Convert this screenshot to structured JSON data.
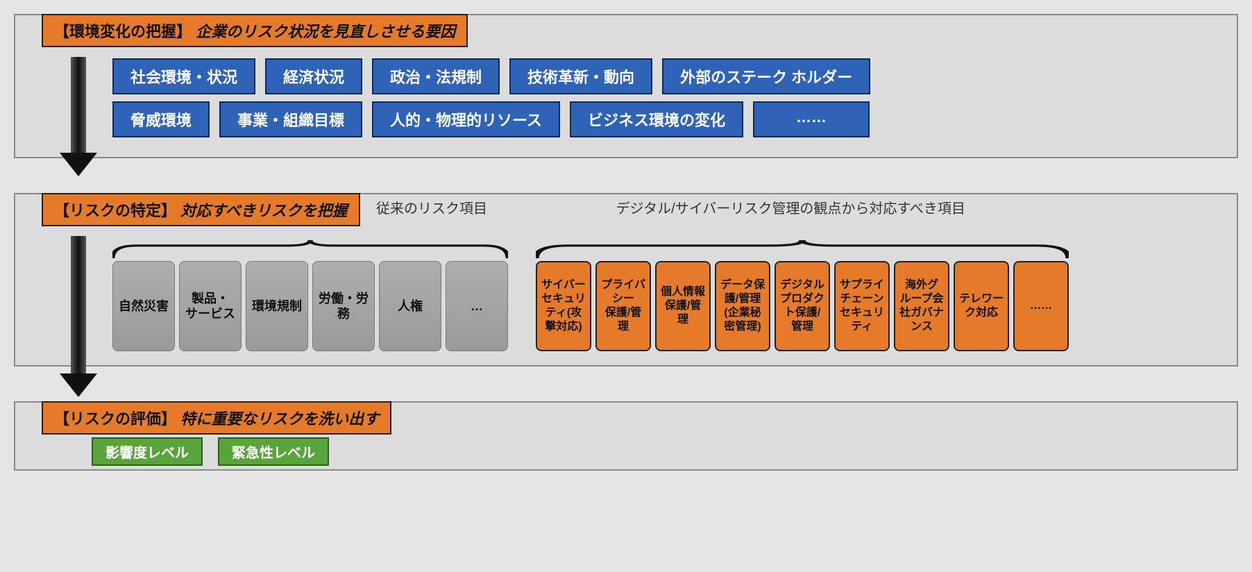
{
  "sections": {
    "env": {
      "title": "【環境変化の把握】",
      "desc": "企業のリスク状況を見直しさせる要因",
      "row1": [
        "社会環境・状況",
        "経済状況",
        "政治・法規制",
        "技術革新・動向",
        "外部のステーク ホルダー"
      ],
      "row2": [
        "脅威環境",
        "事業・組織目標",
        "人的・物理的リソース",
        "ビジネス環境の変化",
        "……"
      ]
    },
    "identify": {
      "title": "【リスクの特定】",
      "desc": "対応すべきリスクを把握",
      "sub1": "従来のリスク項目",
      "sub2": "デジタル/サイバーリスク管理の観点から対応すべき項目",
      "conventional": [
        "自然災害",
        "製品・\nサービス",
        "環境規制",
        "労働・労\n務",
        "人権",
        "…"
      ],
      "digital": [
        "サイバー\nセキュリ\nティ(攻\n撃対応)",
        "プライバ\nシー\n保護/管\n理",
        "個人情報\n保護/管\n理",
        "データ保\n護/管理\n(企業秘\n密管理)",
        "デジタル\nプロダク\nト保護/\n管理",
        "サプライ\nチェーン\nセキュリ\nティ",
        "海外グ\nループ会\n社ガバナ\nンス",
        "テレワー\nク対応",
        "……"
      ]
    },
    "eval": {
      "title": "【リスクの評価】",
      "desc": "特に重要なリスクを洗い出す",
      "tags": [
        "影響度レベル",
        "緊急性レベル"
      ]
    }
  }
}
